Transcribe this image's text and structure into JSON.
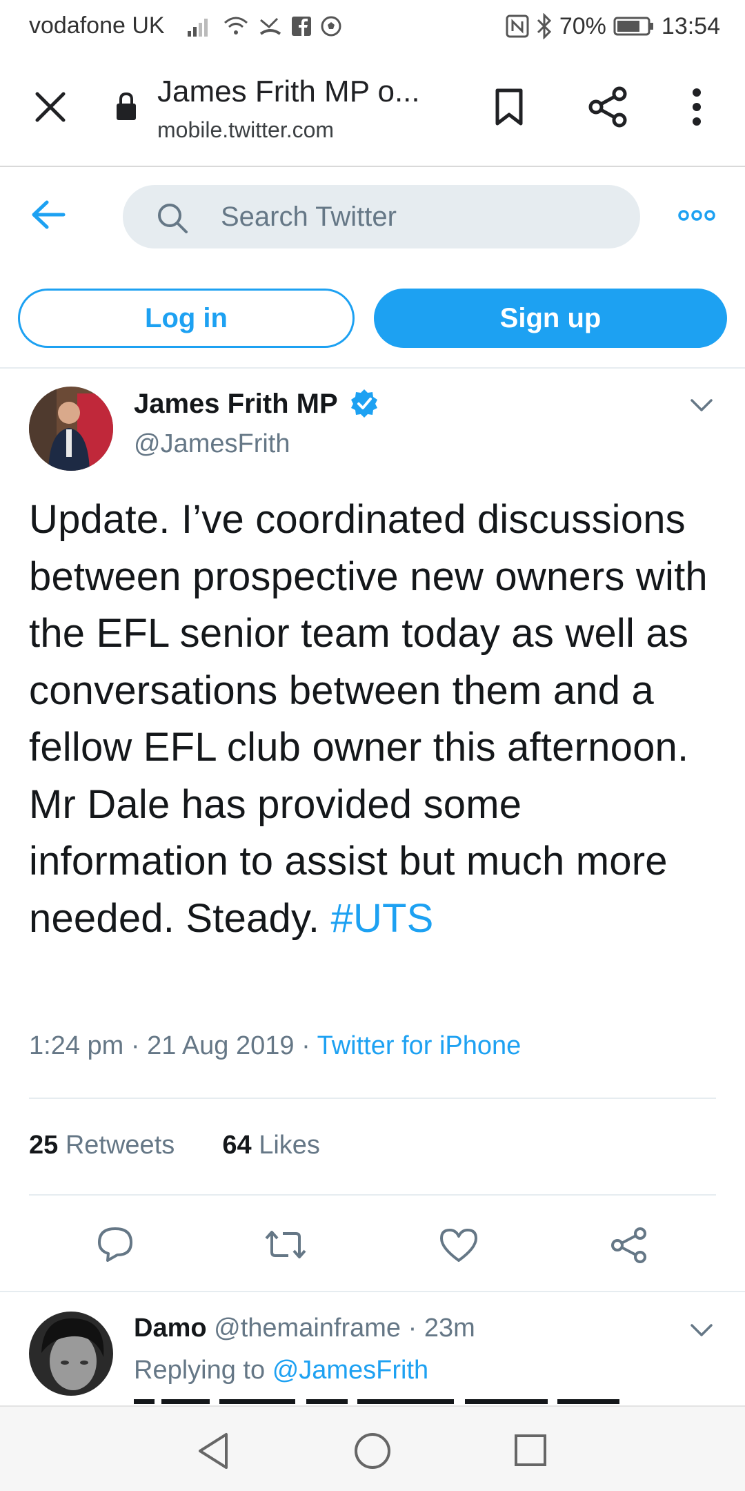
{
  "status_bar": {
    "carrier": "vodafone UK",
    "battery": "70%",
    "time": "13:54"
  },
  "browser": {
    "title": "James Frith MP o...",
    "url": "mobile.twitter.com",
    "icons": [
      "close-icon",
      "lock-icon",
      "bookmark-icon",
      "share-icon",
      "more-vertical-icon"
    ]
  },
  "twitter_header": {
    "search_placeholder": "Search Twitter",
    "login_label": "Log in",
    "signup_label": "Sign up",
    "accent": "#1da1f2"
  },
  "tweet": {
    "author_name": "James Frith MP",
    "handle": "@JamesFrith",
    "text": "Update. I’ve coordinated discussions between prospective new owners with the EFL senior team today as well as conversations between them and a fellow EFL club owner this afternoon. Mr Dale has provided some information to assist but much more needed. Steady.",
    "hashtag": "#UTS",
    "time": "1:24 pm",
    "date": "21 Aug 2019",
    "source": "Twitter for iPhone",
    "retweets_count": "25",
    "retweets_label": "Retweets",
    "likes_count": "64",
    "likes_label": "Likes"
  },
  "reply": {
    "name": "Damo",
    "handle": "@themainframe",
    "age": "23m",
    "replying_label": "Replying to",
    "replying_handle": "@JamesFrith"
  }
}
